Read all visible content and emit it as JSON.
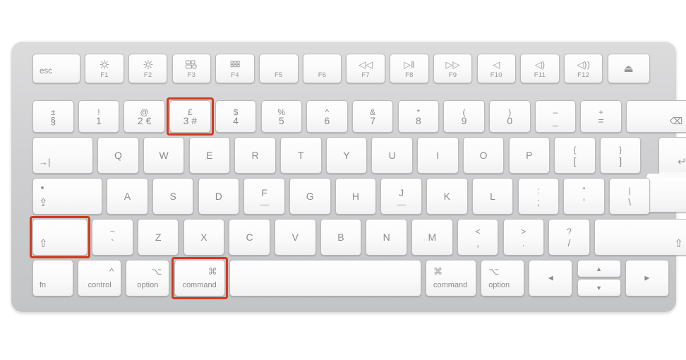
{
  "image": {
    "subject": "apple-magic-keyboard-uk-layout",
    "background_color": "#ffffff",
    "body_color": "#d4d5d7",
    "key_color": "#fafafa",
    "legend_color": "#8a8b8e",
    "highlight_color": "#d2391d",
    "highlight_description": "Red boxes mark the Shift, Command and 3 keys"
  },
  "keyboard": {
    "function_row": [
      {
        "name": "esc",
        "label": "esc"
      },
      {
        "name": "f1",
        "glyph": "☀",
        "label": "F1"
      },
      {
        "name": "f2",
        "glyph": "☀",
        "label": "F2"
      },
      {
        "name": "f3",
        "glyph": "mission-control",
        "label": "F3"
      },
      {
        "name": "f4",
        "glyph": "launchpad",
        "label": "F4"
      },
      {
        "name": "f5",
        "glyph": "",
        "label": "F5"
      },
      {
        "name": "f6",
        "glyph": "",
        "label": "F6"
      },
      {
        "name": "f7",
        "glyph": "◁◁",
        "label": "F7"
      },
      {
        "name": "f8",
        "glyph": "▷‖",
        "label": "F8"
      },
      {
        "name": "f9",
        "glyph": "▷▷",
        "label": "F9"
      },
      {
        "name": "f10",
        "glyph": "◁",
        "label": "F10"
      },
      {
        "name": "f11",
        "glyph": "◁)",
        "label": "F11"
      },
      {
        "name": "f12",
        "glyph": "◁))",
        "label": "F12"
      },
      {
        "name": "eject",
        "glyph": "⏏",
        "label": ""
      }
    ],
    "number_row": [
      {
        "name": "section",
        "top": "±",
        "bottom": "§"
      },
      {
        "name": "1",
        "top": "!",
        "bottom": "1"
      },
      {
        "name": "2",
        "top": "@",
        "bottom": "2 €"
      },
      {
        "name": "3",
        "top": "£",
        "bottom": "3 #",
        "highlighted": true
      },
      {
        "name": "4",
        "top": "$",
        "bottom": "4"
      },
      {
        "name": "5",
        "top": "%",
        "bottom": "5"
      },
      {
        "name": "6",
        "top": "^",
        "bottom": "6"
      },
      {
        "name": "7",
        "top": "&",
        "bottom": "7"
      },
      {
        "name": "8",
        "top": "*",
        "bottom": "8"
      },
      {
        "name": "9",
        "top": "(",
        "bottom": "9"
      },
      {
        "name": "0",
        "top": ")",
        "bottom": "0"
      },
      {
        "name": "minus",
        "top": "–",
        "bottom": "_"
      },
      {
        "name": "equal",
        "top": "+",
        "bottom": "="
      },
      {
        "name": "delete",
        "glyph": "⌫"
      }
    ],
    "top_letter_row": [
      {
        "name": "tab",
        "glyph": "→|"
      },
      {
        "name": "q",
        "label": "Q"
      },
      {
        "name": "w",
        "label": "W"
      },
      {
        "name": "e",
        "label": "E"
      },
      {
        "name": "r",
        "label": "R"
      },
      {
        "name": "t",
        "label": "T"
      },
      {
        "name": "y",
        "label": "Y"
      },
      {
        "name": "u",
        "label": "U"
      },
      {
        "name": "i",
        "label": "I"
      },
      {
        "name": "o",
        "label": "O"
      },
      {
        "name": "p",
        "label": "P"
      },
      {
        "name": "bracket-left",
        "top": "{",
        "bottom": "["
      },
      {
        "name": "bracket-right",
        "top": "}",
        "bottom": "]"
      },
      {
        "name": "return",
        "glyph": "↵"
      }
    ],
    "home_row": [
      {
        "name": "caps-lock",
        "glyph": "⇪"
      },
      {
        "name": "a",
        "label": "A"
      },
      {
        "name": "s",
        "label": "S"
      },
      {
        "name": "d",
        "label": "D"
      },
      {
        "name": "f",
        "label": "F",
        "homing": true
      },
      {
        "name": "g",
        "label": "G"
      },
      {
        "name": "h",
        "label": "H"
      },
      {
        "name": "j",
        "label": "J",
        "homing": true
      },
      {
        "name": "k",
        "label": "K"
      },
      {
        "name": "l",
        "label": "L"
      },
      {
        "name": "semicolon",
        "top": ":",
        "bottom": ";"
      },
      {
        "name": "quote",
        "top": "\"",
        "bottom": "'"
      },
      {
        "name": "backslash",
        "top": "|",
        "bottom": "\\"
      }
    ],
    "bottom_letter_row": [
      {
        "name": "shift-left",
        "glyph": "⇧",
        "highlighted": true
      },
      {
        "name": "grave",
        "top": "~",
        "bottom": "`"
      },
      {
        "name": "z",
        "label": "Z"
      },
      {
        "name": "x",
        "label": "X"
      },
      {
        "name": "c",
        "label": "C"
      },
      {
        "name": "v",
        "label": "V"
      },
      {
        "name": "b",
        "label": "B"
      },
      {
        "name": "n",
        "label": "N"
      },
      {
        "name": "m",
        "label": "M"
      },
      {
        "name": "comma",
        "top": "<",
        "bottom": ","
      },
      {
        "name": "period",
        "top": ">",
        "bottom": "."
      },
      {
        "name": "slash",
        "top": "?",
        "bottom": "/"
      },
      {
        "name": "shift-right",
        "glyph": "⇧"
      }
    ],
    "modifier_row": [
      {
        "name": "fn",
        "label": "fn"
      },
      {
        "name": "control-left",
        "symbol": "^",
        "label": "control"
      },
      {
        "name": "option-left",
        "symbol": "⌥",
        "label": "option"
      },
      {
        "name": "command-left",
        "symbol": "⌘",
        "label": "command",
        "highlighted": true
      },
      {
        "name": "space",
        "label": ""
      },
      {
        "name": "command-right",
        "symbol": "⌘",
        "label": "command"
      },
      {
        "name": "option-right",
        "symbol": "⌥",
        "label": "option"
      },
      {
        "name": "arrow-left",
        "glyph": "◀"
      },
      {
        "name": "arrow-up",
        "glyph": "▲"
      },
      {
        "name": "arrow-down",
        "glyph": "▼"
      },
      {
        "name": "arrow-right",
        "glyph": "▶"
      }
    ]
  }
}
